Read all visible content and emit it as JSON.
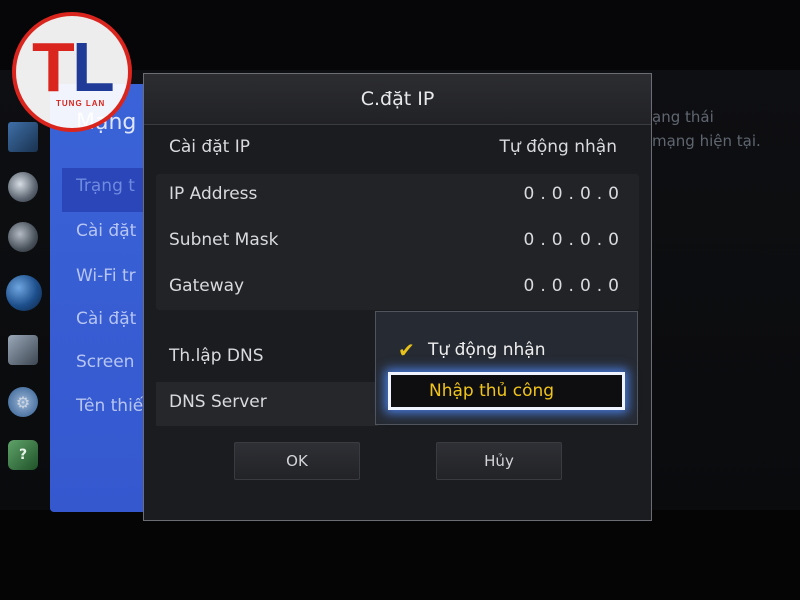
{
  "logo": {
    "letters_left": "T",
    "letters_right": "L",
    "text": "TUNG LAN"
  },
  "side_menu": {
    "title": "Mạng",
    "items": [
      {
        "label": "Trạng t"
      },
      {
        "label": "Cài đặt"
      },
      {
        "label": "Wi-Fi tr"
      },
      {
        "label": "Cài đặt"
      },
      {
        "label": "Screen"
      },
      {
        "label": "Tên thiế"
      }
    ]
  },
  "icons": {
    "help_glyph": "?"
  },
  "right_info": {
    "line1": "ạng thái",
    "line2": "mạng hiện tại."
  },
  "dialog": {
    "title": "C.đặt IP",
    "ip_setting": {
      "label": "Cài đặt IP",
      "value": "Tự động nhận"
    },
    "ip_address": {
      "label": "IP Address",
      "value": "0.0.0.0"
    },
    "subnet_mask": {
      "label": "Subnet Mask",
      "value": "0.0.0.0"
    },
    "gateway": {
      "label": "Gateway",
      "value": "0.0.0.0"
    },
    "dns_setting": {
      "label": "Th.lập DNS"
    },
    "dns_server": {
      "label": "DNS Server"
    },
    "dropdown": {
      "options": [
        {
          "label": "Tự động nhận",
          "selected": true,
          "check": "✔"
        },
        {
          "label": "Nhập thủ công",
          "focused": true
        }
      ]
    },
    "buttons": {
      "ok": "OK",
      "cancel": "Hủy"
    }
  },
  "colors": {
    "menu_blue": "#3b63d8",
    "highlight_yellow": "#f1c41a",
    "focus_glow": "#508cff",
    "logo_red": "#d9251d",
    "logo_blue": "#1f3b97"
  }
}
